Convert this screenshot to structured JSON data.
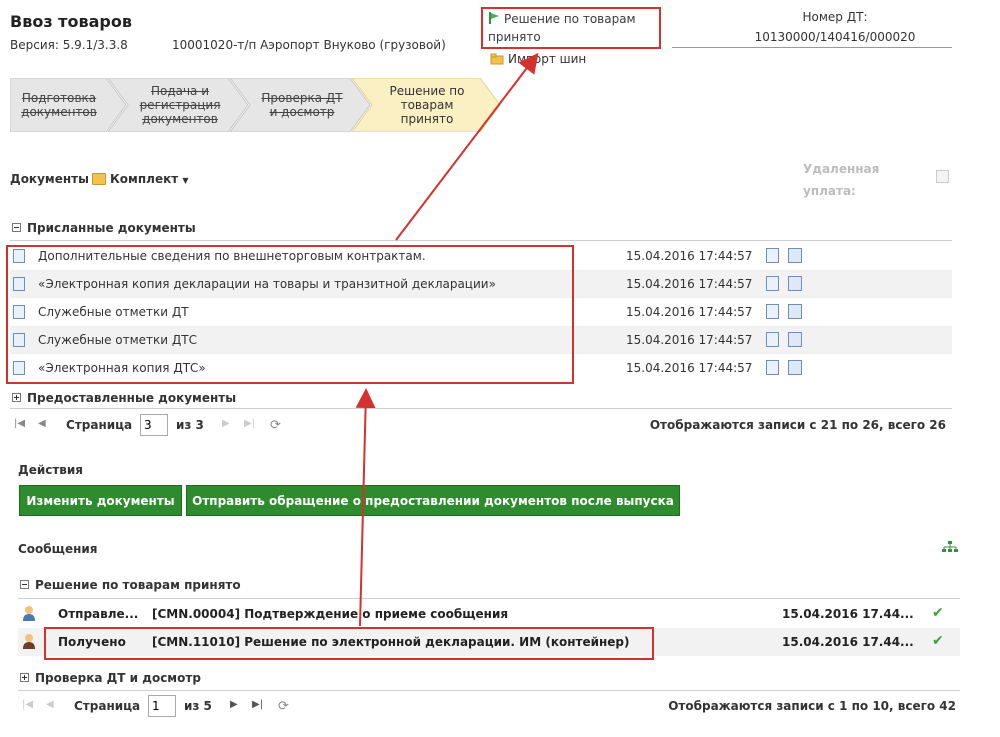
{
  "header": {
    "title": "Ввоз товаров",
    "version": "Версия: 5.9.1/3.3.8",
    "post": "10001020-т/п Аэропорт Внуково (грузовой)",
    "status_line1": "Решение по товарам",
    "status_line2": "принято",
    "dt_label": "Номер ДТ:",
    "dt_value": "10130000/140416/000020",
    "import_label": "Импорт шин"
  },
  "steps": [
    {
      "line1": "Подготовка",
      "line2": "документов",
      "line3": ""
    },
    {
      "line1": "Подача и",
      "line2": "регистрация",
      "line3": "документов"
    },
    {
      "line1": "Проверка ДТ",
      "line2": "и досмотр",
      "line3": ""
    },
    {
      "line1": "Решение по",
      "line2": "товарам",
      "line3": "принято"
    }
  ],
  "docs": {
    "label": "Документы",
    "kit_label": "Комплект",
    "remote_line1": "Удаленная",
    "remote_line2": "уплата:",
    "sent_group": "Присланные документы",
    "provided_group": "Предоставленные документы",
    "rows": [
      {
        "name": "Дополнительные сведения по внешнеторговым контрактам.",
        "date": "15.04.2016 17:44:57"
      },
      {
        "name": "«Электронная копия декларации на товары и транзитной декларации»",
        "date": "15.04.2016 17:44:57"
      },
      {
        "name": "Служебные отметки ДТ",
        "date": "15.04.2016 17:44:57"
      },
      {
        "name": "Служебные отметки ДТС",
        "date": "15.04.2016 17:44:57"
      },
      {
        "name": "«Электронная копия ДТС»",
        "date": "15.04.2016 17:44:57"
      }
    ],
    "pager": {
      "page_label": "Страница",
      "page_value": "3",
      "of_label": "из 3",
      "info": "Отображаются записи с 21 по 26, всего 26"
    }
  },
  "actions": {
    "label": "Действия",
    "btn_change": "Изменить документы",
    "btn_send": "Отправить обращение о предоставлении документов после выпуска"
  },
  "messages": {
    "label": "Сообщения",
    "group1": "Решение по товарам принято",
    "group2": "Проверка ДТ и досмотр",
    "rows": [
      {
        "status": "Отправле...",
        "text": "[CMN.00004] Подтверждение о приеме сообщения",
        "date": "15.04.2016 17.44..."
      },
      {
        "status": "Получено",
        "text": "[CMN.11010] Решение по электронной декларации. ИМ (контейнер)",
        "date": "15.04.2016 17.44..."
      }
    ],
    "pager": {
      "page_label": "Страница",
      "page_value": "1",
      "of_label": "из 5",
      "info": "Отображаются записи с 1 по 10, всего 42"
    }
  },
  "colors": {
    "accent_green": "#2e8b2e",
    "highlight_red": "#d3322f",
    "active_step": "#fbf0c4"
  }
}
